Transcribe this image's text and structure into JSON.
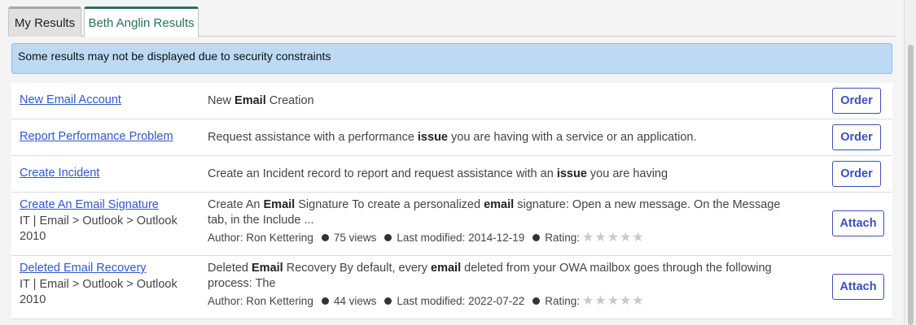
{
  "tabs": [
    {
      "label": "My Results"
    },
    {
      "label": "Beth Anglin Results"
    }
  ],
  "alert": {
    "text": "Some results may not be displayed due to security constraints"
  },
  "results": [
    {
      "title": "New Email Account",
      "desc_pre": "New ",
      "desc_b1": "Email",
      "desc_post": " Creation",
      "button": "Order"
    },
    {
      "title": "Report Performance Problem",
      "desc_pre": "Request assistance with a performance ",
      "desc_b1": "issue",
      "desc_post": " you are having with a service or an application.",
      "button": "Order"
    },
    {
      "title": "Create Incident",
      "desc_pre": "Create an Incident record to report and request assistance with an ",
      "desc_b1": "issue",
      "desc_post": " you are having",
      "button": "Order"
    },
    {
      "title": "Create An Email Signature",
      "path": "IT | Email > Outlook > Outlook 2010",
      "desc_pre": "Create An ",
      "desc_b1": "Email",
      "desc_mid": " Signature To create a personalized ",
      "desc_b2": "email",
      "desc_post": " signature: Open a new message. On the Message tab, in the Include ...",
      "author": "Author: Ron Kettering",
      "views": "75 views",
      "modified": "Last modified: 2014-12-19",
      "rating_label": "Rating:",
      "rating_stars": "★★★★★",
      "rating_value": 0,
      "button": "Attach"
    },
    {
      "title": "Deleted Email Recovery",
      "path": "IT | Email > Outlook > Outlook 2010",
      "desc_pre": "Deleted ",
      "desc_b1": "Email",
      "desc_mid": " Recovery By default, every ",
      "desc_b2": "email",
      "desc_post": " deleted from your OWA mailbox goes through the following process: The",
      "author": "Author: Ron Kettering",
      "views": "44 views",
      "modified": "Last modified: 2022-07-22",
      "rating_label": "Rating:",
      "rating_stars": "★★★★★",
      "rating_value": 0,
      "button": "Attach"
    }
  ],
  "colors": {
    "link": "#2f57c8",
    "accent_tab": "#27725d",
    "button": "#3a4fbf",
    "alert_bg": "#bcdaf3"
  }
}
